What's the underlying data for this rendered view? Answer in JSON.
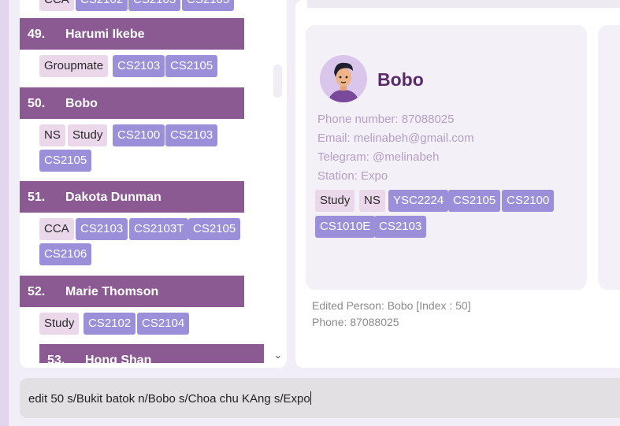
{
  "person_list": {
    "partial_top_tags": [
      "CCA",
      "CS2102",
      "CS2103",
      "CS2105"
    ],
    "cards": [
      {
        "index": "49.",
        "name": "Harumi Ikebe",
        "tags": [
          "Groupmate"
        ],
        "modules": [
          "CS2103",
          "CS2105"
        ]
      },
      {
        "index": "50.",
        "name": "Bobo",
        "tags": [
          "NS",
          "Study"
        ],
        "modules": [
          "CS2100",
          "CS2103",
          "CS2105"
        ]
      },
      {
        "index": "51.",
        "name": "Dakota Dunman",
        "tags": [
          "CCA"
        ],
        "modules": [
          "CS2103",
          "CS2103T",
          "CS2105",
          "CS2106"
        ]
      },
      {
        "index": "52.",
        "name": "Marie Thomson",
        "tags": [
          "Study"
        ],
        "modules": [
          "CS2102",
          "CS2104"
        ]
      },
      {
        "index": "53.",
        "name": "Hong Shan",
        "tags": [],
        "modules": []
      }
    ]
  },
  "detail": {
    "name": "Bobo",
    "phone": "Phone number: 87088025",
    "email": "Email: melinabeh@gmail.com",
    "telegram": "Telegram: @melinabeh",
    "station": "Station: Expo",
    "tags": [
      "Study",
      "NS"
    ],
    "modules": [
      "YSC2224",
      "CS2105",
      "CS2100",
      "CS1010E",
      "CS2103"
    ]
  },
  "result": {
    "line1": "Edited Person: Bobo [Index : 50]",
    "line2": "Phone: 87088025"
  },
  "command": {
    "value": "edit 50 s/Bukit batok n/Bobo s/Choa chu KAng s/Expo"
  },
  "colors": {
    "card_header": "#8b5a92",
    "tag_light": "#ead7ea",
    "tag_module": "#9b8fd9",
    "name_text": "#5a2a6d"
  },
  "icons": {
    "scroll_down": "chevron-down-icon",
    "avatar": "person-avatar-icon"
  }
}
